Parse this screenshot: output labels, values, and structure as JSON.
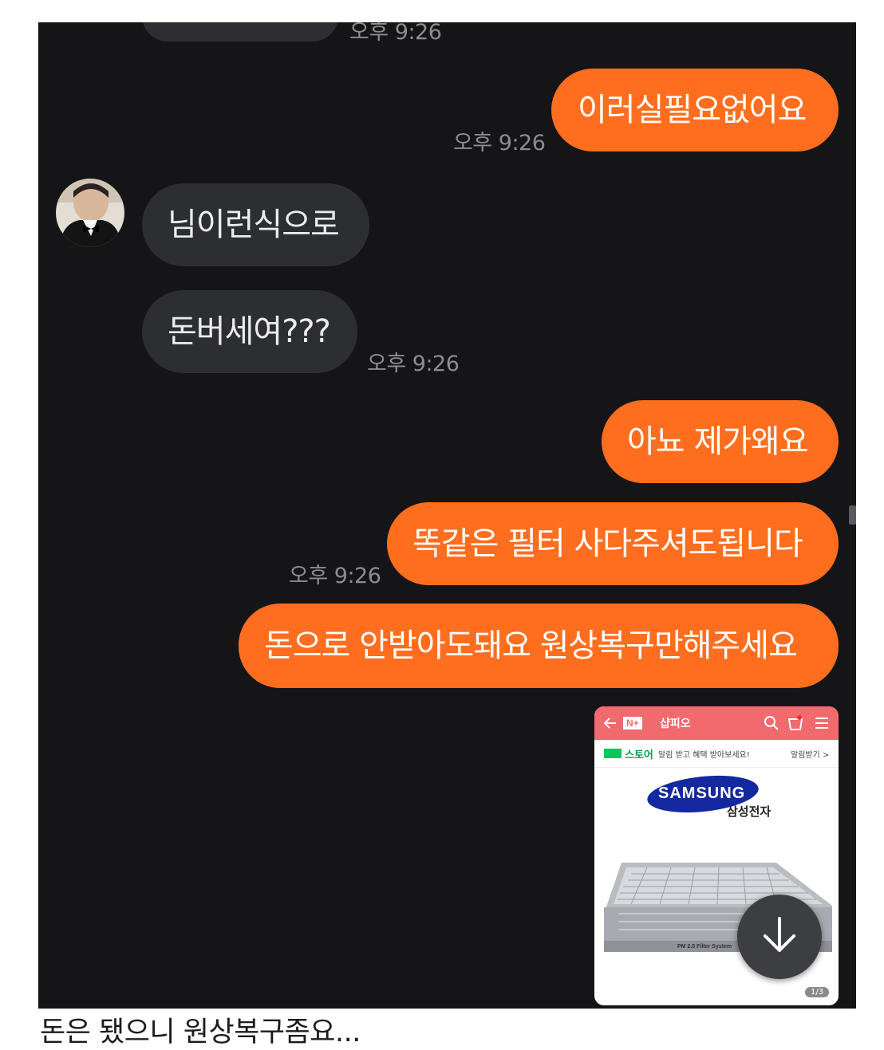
{
  "chat": {
    "messages": [
      {
        "from": "me",
        "text": "이러실필요없어요"
      },
      {
        "from": "them",
        "text": "님이런식으로"
      },
      {
        "from": "them",
        "text": "돈버세여???"
      },
      {
        "from": "me",
        "text": "아뇨 제가왜요"
      },
      {
        "from": "me",
        "text": "똑같은 필터 사다주셔도됩니다"
      },
      {
        "from": "me",
        "text": "돈으로 안받아도돼요 원상복구만해주세요"
      }
    ],
    "timestamps": [
      "오후 9:26",
      "오후 9:26",
      "오후 9:26",
      "오후 9:26"
    ]
  },
  "attachment": {
    "header_title": "샵피오",
    "header_badge": "N+",
    "banner_brand": "스토어",
    "banner_text": "알림 받고 혜택 받아보세요!",
    "banner_action": "알림받기 >",
    "brand_logo": "SAMSUNG",
    "brand_korean": "삼성전자",
    "product_label": "PM 2.5 Filter System",
    "page_indicator": "1/3"
  },
  "caption": "돈은 됐으니 원상복구좀요...",
  "colors": {
    "my_bubble": "#ff6e1f",
    "their_bubble": "#2d2e32",
    "chat_bg": "#151518",
    "store_header": "#f06a6e",
    "naver_green": "#03c75a",
    "samsung_blue": "#1428a0"
  },
  "icons": [
    "back-arrow-icon",
    "search-icon",
    "cart-icon",
    "menu-icon",
    "arrow-down-icon"
  ]
}
